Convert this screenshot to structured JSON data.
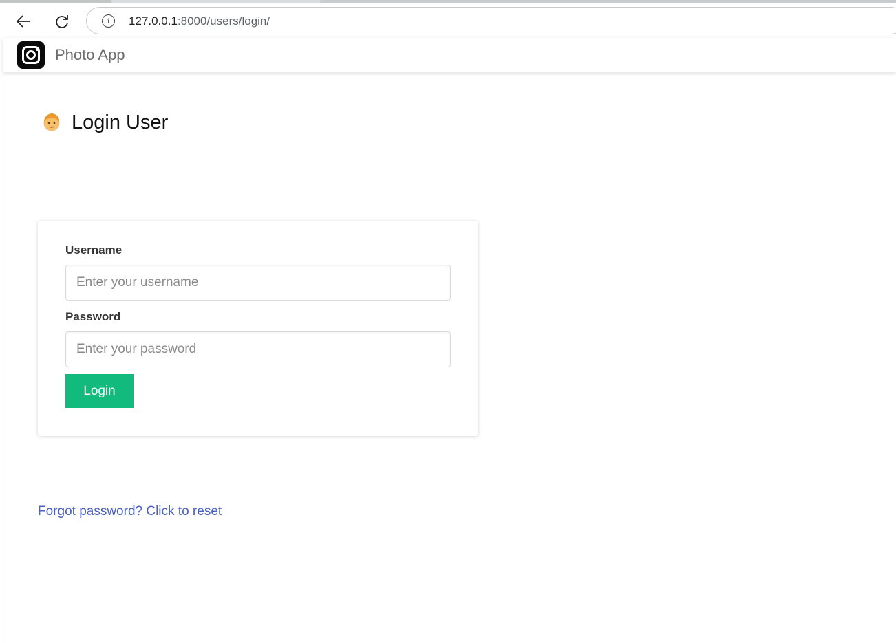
{
  "browser": {
    "url_host": "127.0.0.1",
    "url_rest": ":8000/users/login/",
    "icons": {
      "back": "back-arrow-icon",
      "reload": "reload-icon",
      "info": "info-icon"
    }
  },
  "navbar": {
    "brand_name": "Photo App",
    "logo_icon": "camera-icon"
  },
  "header": {
    "title": "Login User",
    "icon": "person-face-icon"
  },
  "form": {
    "username_label": "Username",
    "username_placeholder": "Enter your username",
    "username_value": "",
    "password_label": "Password",
    "password_placeholder": "Enter your password",
    "password_value": "",
    "submit_label": "Login"
  },
  "links": {
    "forgot_password": "Forgot password? Click to reset"
  },
  "colors": {
    "accent_green": "#13ba7d",
    "link_blue": "#485fc7"
  }
}
